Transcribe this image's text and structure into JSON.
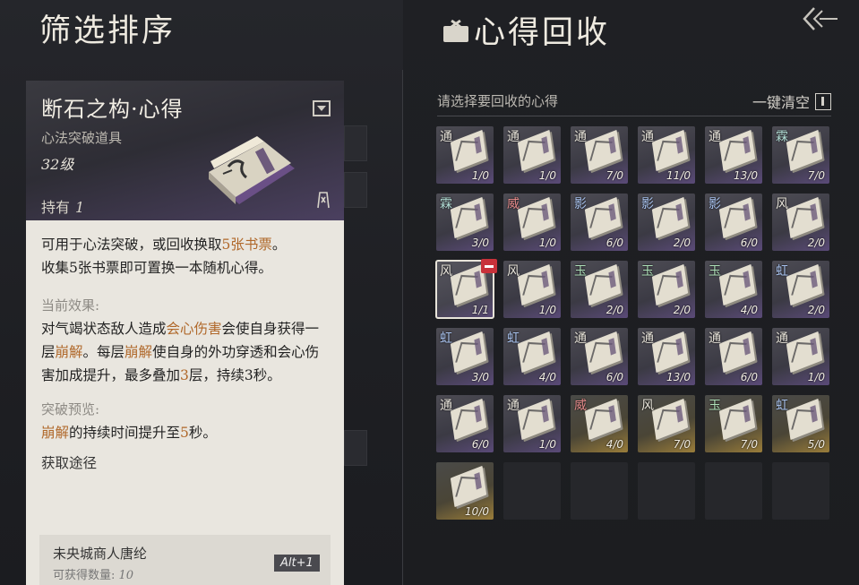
{
  "left_panel": {
    "title": "筛选排序"
  },
  "right_panel": {
    "title": "心得回收",
    "select_prompt": "请选择要回收的心得",
    "clear_label": "一键清空"
  },
  "item_card": {
    "name": "断石之构·心得",
    "type": "心法突破道具",
    "level": "32级",
    "hold_label": "持有",
    "hold_count": "1",
    "desc_line1_a": "可用于心法突破，或回收换取",
    "desc_line1_hl": "5张书票",
    "desc_line1_b": "。",
    "desc_line2": "收集5张书票即可置换一本随机心得。",
    "effect_label": "当前效果:",
    "effect_a": "对气竭状态敌人造成",
    "effect_hl1": "会心伤害",
    "effect_b": "会使自身获得一层",
    "effect_hl2": "崩解",
    "effect_c": "。每层",
    "effect_hl3": "崩解",
    "effect_d": "使自身的外功穿透和会心伤害加成提升，最多叠加",
    "effect_hl4": "3",
    "effect_e": "层，持续3秒。",
    "preview_label": "突破预览:",
    "preview_hl1": "崩解",
    "preview_a": "的持续时间提升至",
    "preview_hl2": "5",
    "preview_b": "秒。",
    "source_label": "获取途径",
    "source_name": "未央城商人唐纶",
    "source_count_label": "可获得数量:",
    "source_count": "10",
    "source_key": "Alt+1"
  },
  "slots": [
    {
      "tag": "通",
      "count": "1/0",
      "style": "filled",
      "tag_color": "normal"
    },
    {
      "tag": "通",
      "count": "1/0",
      "style": "filled",
      "tag_color": "normal"
    },
    {
      "tag": "通",
      "count": "7/0",
      "style": "filled",
      "tag_color": "normal"
    },
    {
      "tag": "通",
      "count": "11/0",
      "style": "filled",
      "tag_color": "normal"
    },
    {
      "tag": "通",
      "count": "13/0",
      "style": "filled",
      "tag_color": "normal"
    },
    {
      "tag": "霖",
      "count": "7/0",
      "style": "filled",
      "tag_color": "teal"
    },
    {
      "tag": "霖",
      "count": "3/0",
      "style": "filled",
      "tag_color": "teal"
    },
    {
      "tag": "威",
      "count": "1/0",
      "style": "filled",
      "tag_color": "red"
    },
    {
      "tag": "影",
      "count": "6/0",
      "style": "filled",
      "tag_color": "blue"
    },
    {
      "tag": "影",
      "count": "2/0",
      "style": "filled",
      "tag_color": "blue"
    },
    {
      "tag": "影",
      "count": "6/0",
      "style": "filled",
      "tag_color": "blue"
    },
    {
      "tag": "风",
      "count": "2/0",
      "style": "filled",
      "tag_color": "normal"
    },
    {
      "tag": "风",
      "count": "1/1",
      "style": "selected",
      "tag_color": "normal"
    },
    {
      "tag": "风",
      "count": "1/0",
      "style": "filled",
      "tag_color": "normal"
    },
    {
      "tag": "玉",
      "count": "2/0",
      "style": "filled",
      "tag_color": "green"
    },
    {
      "tag": "玉",
      "count": "2/0",
      "style": "filled",
      "tag_color": "green"
    },
    {
      "tag": "玉",
      "count": "4/0",
      "style": "filled",
      "tag_color": "green"
    },
    {
      "tag": "虹",
      "count": "2/0",
      "style": "filled",
      "tag_color": "blue"
    },
    {
      "tag": "虹",
      "count": "3/0",
      "style": "filled",
      "tag_color": "blue"
    },
    {
      "tag": "虹",
      "count": "4/0",
      "style": "filled",
      "tag_color": "blue"
    },
    {
      "tag": "通",
      "count": "6/0",
      "style": "filled",
      "tag_color": "normal"
    },
    {
      "tag": "通",
      "count": "13/0",
      "style": "filled",
      "tag_color": "normal"
    },
    {
      "tag": "通",
      "count": "6/0",
      "style": "filled",
      "tag_color": "normal"
    },
    {
      "tag": "通",
      "count": "1/0",
      "style": "filled",
      "tag_color": "normal"
    },
    {
      "tag": "通",
      "count": "6/0",
      "style": "filled",
      "tag_color": "normal"
    },
    {
      "tag": "通",
      "count": "1/0",
      "style": "filled",
      "tag_color": "normal"
    },
    {
      "tag": "威",
      "count": "4/0",
      "style": "gold",
      "tag_color": "red"
    },
    {
      "tag": "风",
      "count": "7/0",
      "style": "gold",
      "tag_color": "normal"
    },
    {
      "tag": "玉",
      "count": "7/0",
      "style": "gold",
      "tag_color": "green"
    },
    {
      "tag": "虹",
      "count": "5/0",
      "style": "gold",
      "tag_color": "blue"
    },
    {
      "tag": "",
      "count": "10/0",
      "style": "gold",
      "tag_color": "normal"
    },
    {
      "tag": "",
      "count": "",
      "style": "empty",
      "tag_color": "normal"
    },
    {
      "tag": "",
      "count": "",
      "style": "empty",
      "tag_color": "normal"
    },
    {
      "tag": "",
      "count": "",
      "style": "empty",
      "tag_color": "normal"
    },
    {
      "tag": "",
      "count": "",
      "style": "empty",
      "tag_color": "normal"
    },
    {
      "tag": "",
      "count": "",
      "style": "empty",
      "tag_color": "normal"
    }
  ]
}
